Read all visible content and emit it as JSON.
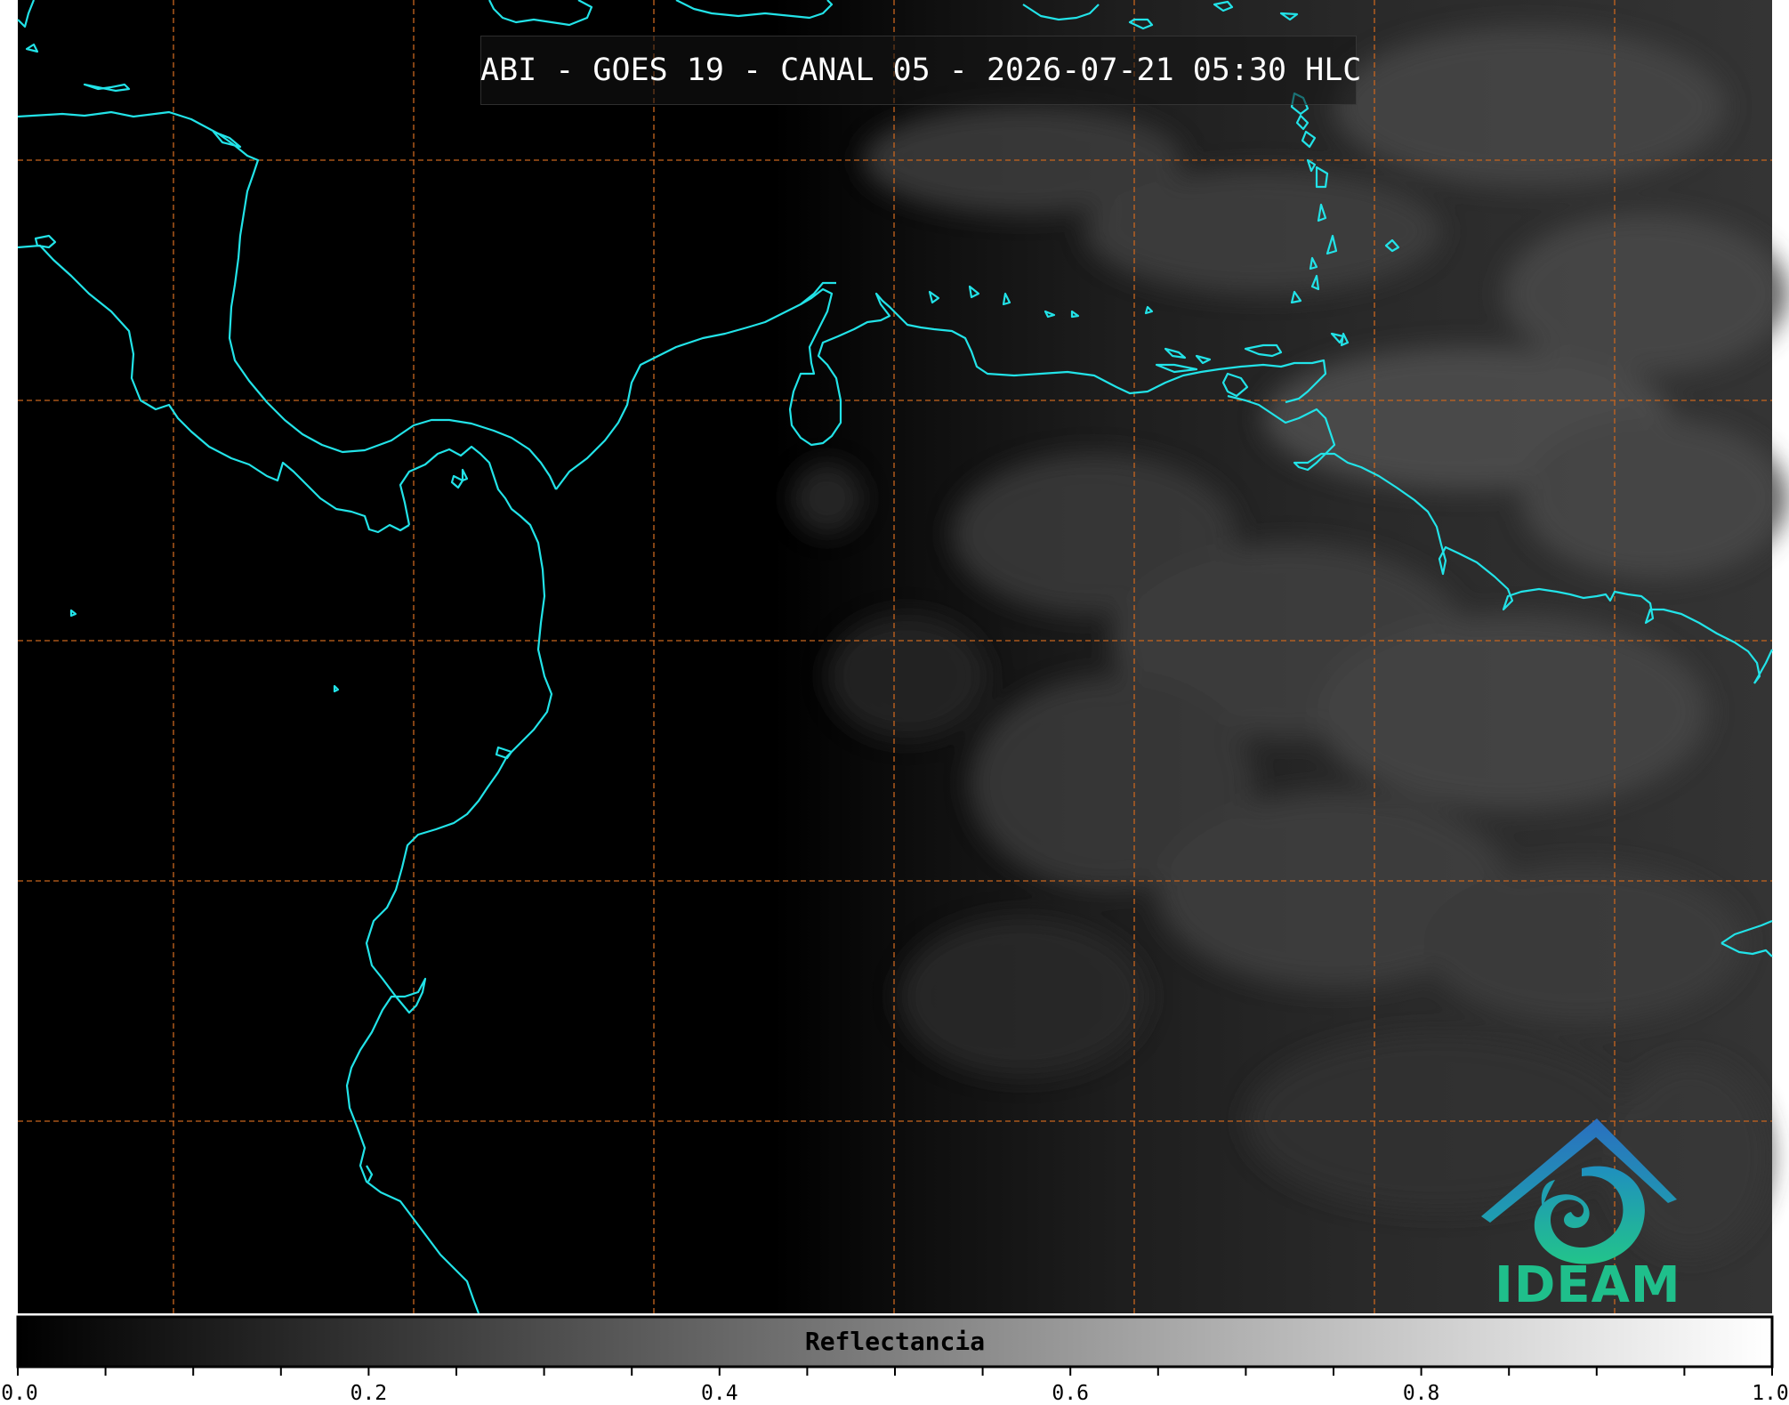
{
  "title": "ABI - GOES 19 - CANAL 05 - 2026-07-21 05:30 HLC",
  "logo": {
    "text": "IDEAM",
    "colors": {
      "roof": "#2a6fc0",
      "swirl": "#1fb59a"
    }
  },
  "colorbar": {
    "label": "Reflectancia",
    "range": [
      0.0,
      1.0
    ],
    "colormap": "grayscale",
    "ticks": [
      "0.0",
      "0.2",
      "0.4",
      "0.6",
      "0.8",
      "1.0"
    ],
    "tick_values": [
      0.0,
      0.2,
      0.4,
      0.6,
      0.8,
      1.0
    ]
  },
  "map_style": {
    "background": "#000000",
    "coastline_color": "#22e3e8",
    "graticule_color": "#c8651e",
    "graticule_style": "dashed",
    "graticule_columns": 8,
    "graticule_rows": 6
  }
}
